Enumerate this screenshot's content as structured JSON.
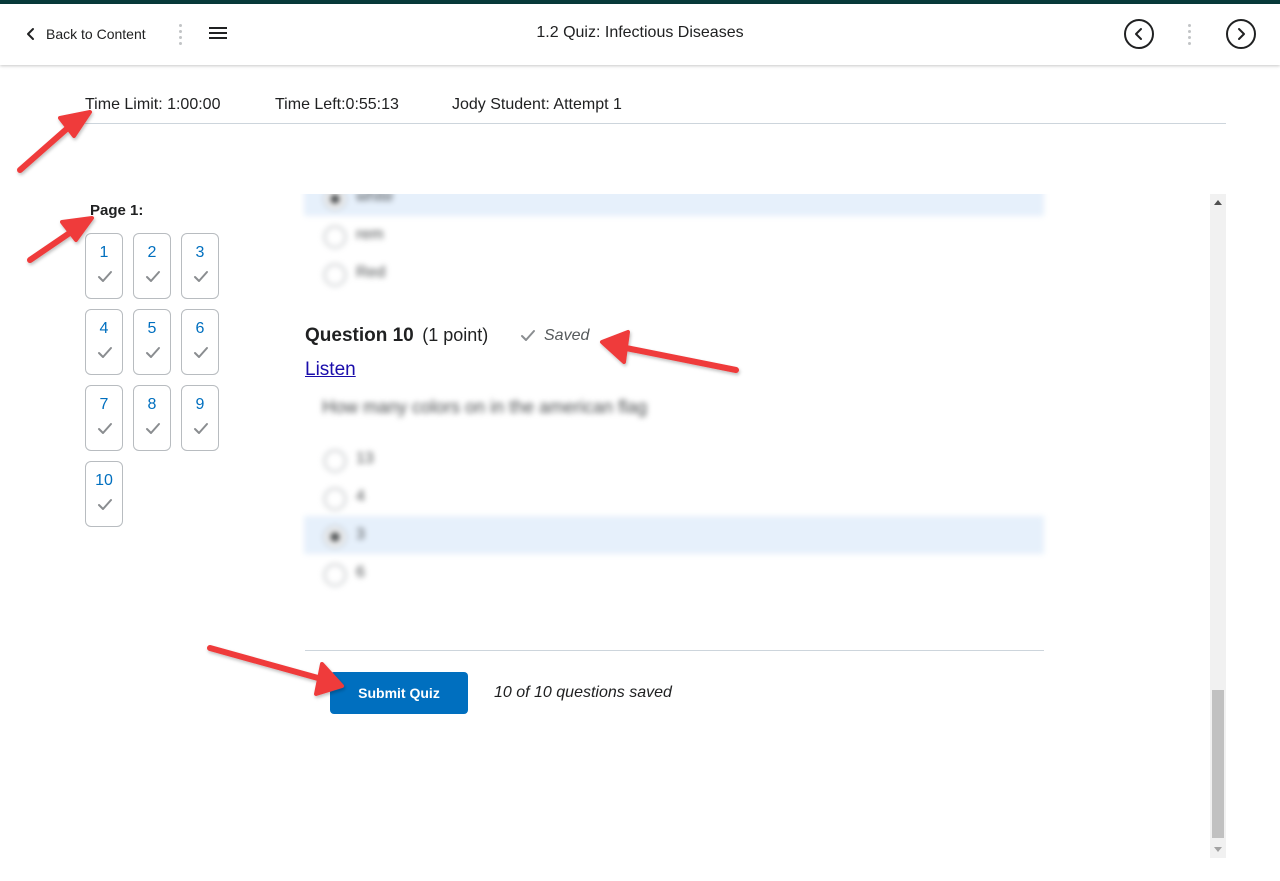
{
  "header": {
    "back_label": "Back to Content",
    "title": "1.2 Quiz: Infectious Diseases",
    "prev_icon": "chevron-left-circle-icon",
    "next_icon": "chevron-right-circle-icon",
    "menu_icon": "hamburger-icon"
  },
  "quiz_info": {
    "time_limit": "Time Limit: 1:00:00",
    "time_left": "Time Left:0:55:13",
    "attempt": "Jody Student: Attempt 1"
  },
  "nav": {
    "page_label": "Page 1:",
    "questions": [
      {
        "label": "1",
        "answered": true
      },
      {
        "label": "2",
        "answered": true
      },
      {
        "label": "3",
        "answered": true
      },
      {
        "label": "4",
        "answered": true
      },
      {
        "label": "5",
        "answered": true
      },
      {
        "label": "6",
        "answered": true
      },
      {
        "label": "7",
        "answered": true
      },
      {
        "label": "8",
        "answered": true
      },
      {
        "label": "9",
        "answered": true
      },
      {
        "label": "10",
        "answered": true
      }
    ]
  },
  "prev_question": {
    "options": [
      {
        "text": "white",
        "selected": true
      },
      {
        "text": "rem",
        "selected": false
      },
      {
        "text": "Red",
        "selected": false
      }
    ]
  },
  "question": {
    "title": "Question 10",
    "points": "(1 point)",
    "status": "Saved",
    "listen_label": "Listen",
    "text": "How many colors on in the american flag",
    "options": [
      {
        "text": "13",
        "selected": false
      },
      {
        "text": "4",
        "selected": false
      },
      {
        "text": "3",
        "selected": true
      },
      {
        "text": "6",
        "selected": false
      }
    ]
  },
  "footer": {
    "submit_label": "Submit Quiz",
    "saved_count": "10 of 10 questions saved"
  },
  "colors": {
    "accent": "#006fbf",
    "top_strip": "#083a3a",
    "annotation_arrow": "#ef3b3b",
    "selected_row": "#e6f0fb"
  }
}
